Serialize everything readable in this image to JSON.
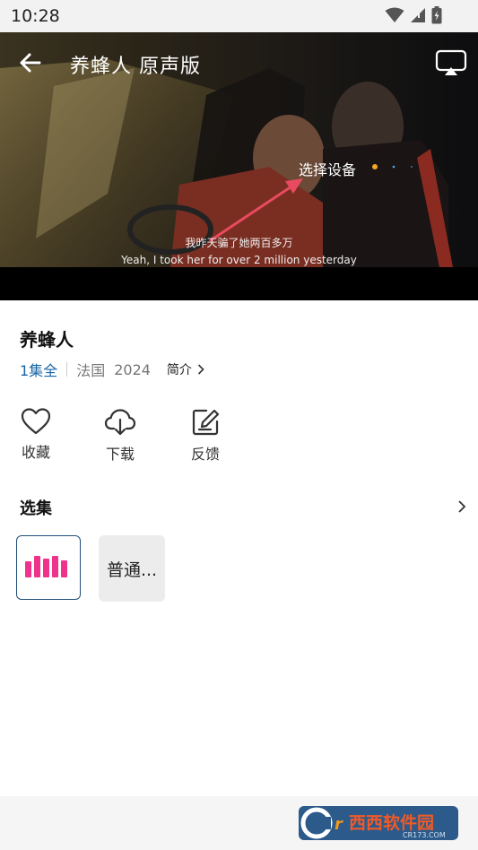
{
  "status_bar": {
    "time": "10:28"
  },
  "video": {
    "title": "养蜂人 原声版",
    "device_label": "选择设备",
    "subtitle_cn": "我昨天骗了她两百多万",
    "subtitle_en": "Yeah, I took her for over 2 million yesterday"
  },
  "info": {
    "title": "养蜂人",
    "episodes": "1集全",
    "region": "法国",
    "year": "2024",
    "intro": "简介"
  },
  "actions": {
    "favorite": "收藏",
    "download": "下载",
    "feedback": "反馈"
  },
  "episodes": {
    "header": "选集",
    "items": [
      {
        "label": "",
        "playing": true
      },
      {
        "label": "普通..."
      }
    ]
  },
  "watermark": {
    "main_text": "西西软件园",
    "sub_text": "CR173.COM"
  },
  "colors": {
    "accent_blue": "#1a66a6",
    "playing_pink": "#f0338a",
    "annotation_red": "#e84a5f",
    "device_dot": "#f5a623"
  }
}
